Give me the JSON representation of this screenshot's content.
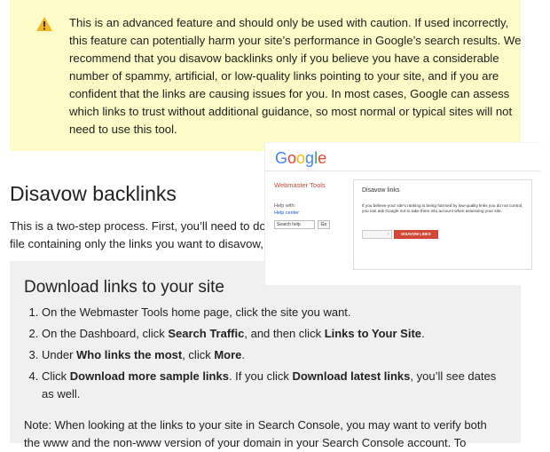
{
  "warning": {
    "icon": "warning-triangle-icon",
    "text": "This is an advanced feature and should only be used with caution. If used incorrectly, this feature can potentially harm your site’s performance in Google’s search results. We recommend that you disavow backlinks only if you believe you have a considerable number of spammy, artificial, or low-quality links pointing to your site, and if you are confident that the links are causing issues for you. In most cases, Google can assess which links to trust without additional guidance, so most normal or typical sites will not need to use this tool."
  },
  "section": {
    "title": "Disavow backlinks",
    "intro_line1": "This is a two-step process. First, you’ll need to dow",
    "intro_line2": "file containing only the links you want to disavow, ar"
  },
  "download": {
    "title": "Download links to your site",
    "steps": [
      {
        "pre": "On the Webmaster Tools home page, click the site you want.",
        "b1": "",
        "mid": "",
        "b2": "",
        "post": ""
      },
      {
        "pre": "On the Dashboard, click ",
        "b1": "Search Traffic",
        "mid": ", and then click ",
        "b2": "Links to Your Site",
        "post": "."
      },
      {
        "pre": "Under ",
        "b1": "Who links the most",
        "mid": ", click ",
        "b2": "More",
        "post": "."
      },
      {
        "pre": "Click ",
        "b1": "Download more sample links",
        "mid": ". If you click ",
        "b2": "Download latest links",
        "post": ", you’ll see dates as well."
      }
    ],
    "note_line1": "Note: When looking at the links to your site in Search Console, you may want to verify both",
    "note_line2": "the www and the non-www version of your domain in your Search Console account. To"
  },
  "screenshot": {
    "logo_letters": [
      "G",
      "o",
      "o",
      "g",
      "l",
      "e"
    ],
    "logo_colors": [
      "#4285f4",
      "#ea4335",
      "#fbbc05",
      "#4285f4",
      "#34a853",
      "#ea4335"
    ],
    "app_title": "Webmaster Tools",
    "help_label": "Help with:",
    "help_link": "Help center",
    "search_placeholder": "Search help",
    "go_label": "Go",
    "panel_title": "Disavow links",
    "panel_text": "If you believe your site's ranking is being harmed by low-quality links you do not control, you can ask Google not to take them into account when assessing your site.",
    "select_label": "÷",
    "button_label": "DISAVOW LINKS",
    "accent": "#d14836"
  },
  "colors": {
    "warning_bg": "#fdfcc9",
    "warning_icon": "#f3b61f",
    "box_bg": "#f0f0f0"
  }
}
